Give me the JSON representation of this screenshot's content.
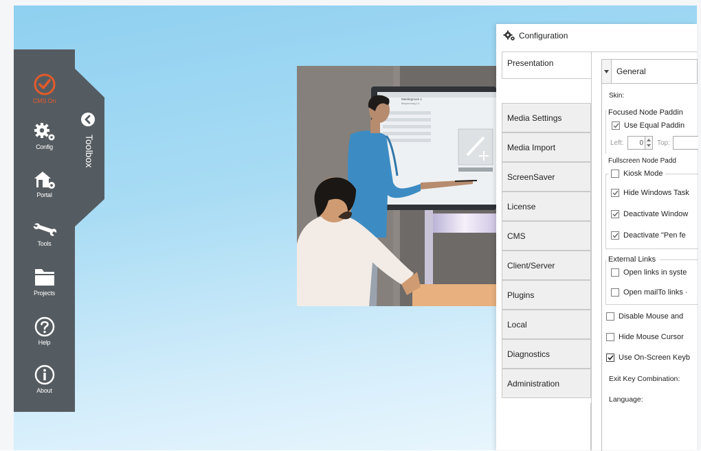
{
  "sidebar": {
    "items": [
      {
        "label": "CMS On",
        "icon": "check-circle-icon"
      },
      {
        "label": "Config",
        "icon": "gears-icon"
      },
      {
        "label": "Portal",
        "icon": "portal-house-gear-icon"
      },
      {
        "label": "Tools",
        "icon": "wrench-icon"
      },
      {
        "label": "Projects",
        "icon": "folder-icon"
      },
      {
        "label": "Help",
        "icon": "question-circle-icon"
      },
      {
        "label": "About",
        "icon": "info-circle-icon"
      }
    ],
    "toolbox_label": "Toolbox",
    "colors": {
      "panel": "#555c61",
      "accent": "#e25b2b"
    }
  },
  "config": {
    "title": "Configuration",
    "tabs": [
      "Presentation",
      "Media Settings",
      "Media Import",
      "ScreenSaver",
      "License",
      "CMS",
      "Client/Server",
      "Plugins",
      "Local",
      "Diagnostics",
      "Administration"
    ],
    "active_tab": "Presentation",
    "section": "General",
    "skin_label": "Skin:",
    "focused_padding_label": "Focused Node Paddin",
    "use_equal_padding": {
      "label": "Use Equal Paddin",
      "checked": true
    },
    "left_label": "Left:",
    "left_value": "0",
    "top_label": "Top:",
    "fullscreen_padding_label": "Fullscreen Node Padd",
    "kiosk_mode": {
      "label": "Kiosk Mode",
      "checked": false
    },
    "hide_taskbar": {
      "label": "Hide Windows Task",
      "checked": true
    },
    "deactivate_windows": {
      "label": "Deactivate Window",
      "checked": true
    },
    "deactivate_pen": {
      "label": "Deactivate \"Pen fe",
      "checked": true
    },
    "external_links_label": "External Links",
    "open_links_system": {
      "label": "Open links in syste",
      "checked": false
    },
    "open_mailto": {
      "label": "Open mailTo links ·",
      "checked": false
    },
    "disable_mouse": {
      "label": "Disable Mouse and",
      "checked": false
    },
    "hide_cursor": {
      "label": "Hide Mouse Cursor",
      "checked": false
    },
    "onscreen_keyboard": {
      "label": "Use On-Screen Keyb",
      "checked": true
    },
    "exit_key_label": "Exit Key Combination:",
    "language_label": "Language:"
  },
  "illustration": {
    "screen_heading": "Meetingroom 1",
    "screen_subheading": "Besprechung 1.4"
  }
}
